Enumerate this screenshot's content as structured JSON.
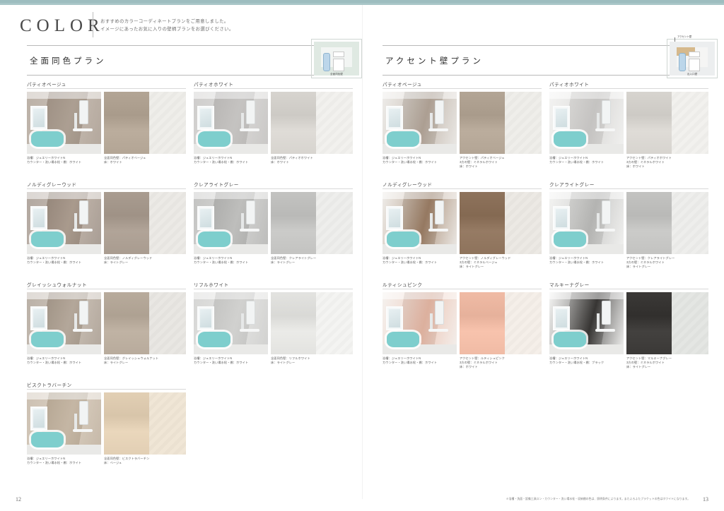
{
  "header": {
    "title": "COLOR",
    "lead_line1": "おすすめのカラーコーディネートプランをご用意しました。",
    "lead_line2": "イメージにあったお気に入りの壁柄プランをお選びください。"
  },
  "colors": {
    "top_bar": "#a8c5c7",
    "rule": "#b9b9b9",
    "text": "#4a4a4a",
    "accent_wall_swatch": "#d6b98c",
    "tub": "#7ececd"
  },
  "sections": [
    {
      "id": "zenmen",
      "title": "全面同色プラン",
      "thumb": {
        "type": "same-color-plan-diagram",
        "caption": "全面同色壁",
        "labels": [
          "鏡",
          "カウンター",
          "出入口"
        ]
      },
      "cards": [
        {
          "title": "パティオベージュ",
          "photo_wall": "#b5a79a",
          "photo_wall2": "#9d8e80",
          "sw_main": "#b3a595",
          "sw_side": "#efeeea",
          "cap_left": [
            "浴槽：ジュエリーホワイトN",
            "カウンター・洗い場水栓・棚：ホワイト"
          ],
          "cap_right": [
            "全面同色壁：パティオベージュ",
            "床：ホワイト"
          ]
        },
        {
          "title": "パティオホワイト",
          "photo_wall": "#cfcdcb",
          "photo_wall2": "#b9b7b5",
          "sw_main": "#d7d4cf",
          "sw_side": "#f2f1ee",
          "cap_left": [
            "浴槽：ジュエリーホワイトN",
            "カウンター・洗い場水栓・棚：ホワイト"
          ],
          "cap_right": [
            "全面同色壁：パティオホワイト",
            "床：ホワイト"
          ]
        },
        {
          "title": "ノルディグレーウッド",
          "photo_wall": "#b2a294",
          "photo_wall2": "#8e8075",
          "sw_main": "#a99c90",
          "sw_side": "#eceae6",
          "cap_left": [
            "浴槽：ジュエリーホワイトN",
            "カウンター・洗い場水栓・棚：ホワイト"
          ],
          "cap_right": [
            "全面同色壁：ノルディグレーウッド",
            "床：ライトグレー"
          ]
        },
        {
          "title": "クレアライトグレー",
          "photo_wall": "#c8c8c6",
          "photo_wall2": "#a9a9a7",
          "sw_main": "#c3c3c1",
          "sw_side": "#eeeeec",
          "cap_left": [
            "浴槽：ジュエリーホワイトN",
            "カウンター・洗い場水栓・棚：ホワイト"
          ],
          "cap_right": [
            "全面同色壁：クレアライトグレー",
            "床：ライトグレー"
          ]
        },
        {
          "title": "グレイッシュウォルナット",
          "photo_wall": "#bdb0a2",
          "photo_wall2": "#9b8d7f",
          "sw_main": "#b8ab9c",
          "sw_side": "#e9e7e3",
          "cap_left": [
            "浴槽：ジュエリーホワイトN",
            "カウンター・洗い場水栓・棚：ホワイト"
          ],
          "cap_right": [
            "全面同色壁：グレイッシュウォルナット",
            "床：ライトグレー"
          ]
        },
        {
          "title": "リフルホワイト",
          "photo_wall": "#dcdcda",
          "photo_wall2": "#c4c4c2",
          "sw_main": "#e3e3e0",
          "sw_side": "#f4f4f2",
          "cap_left": [
            "浴槽：ジュエリーホワイトN",
            "カウンター・洗い場水栓・棚：ホワイト"
          ],
          "cap_right": [
            "全面同色壁：リフルホワイト",
            "床：ライトグレー"
          ]
        },
        {
          "title": "ビスクトラバーチン",
          "photo_wall": "#cfc0ad",
          "photo_wall2": "#b5a48f",
          "sw_main": "#e2cfb4",
          "sw_side": "#f0e6d6",
          "cap_left": [
            "浴槽：ジュエリーホワイトN",
            "カウンター・洗い場水栓・棚：ホワイト"
          ],
          "cap_right": [
            "全面同色壁：ビスクトラバーチン",
            "床：ベージュ"
          ]
        }
      ]
    },
    {
      "id": "accent",
      "title": "アクセント壁プラン",
      "thumb": {
        "type": "accent-wall-plan-diagram",
        "caption": "出入口壁",
        "accent_label": "アクセント壁",
        "labels": [
          "鏡",
          "カウンター",
          "出入口"
        ]
      },
      "cards": [
        {
          "title": "パティオベージュ",
          "photo_wall": "#b5a79a",
          "photo_wall2": "#e6e4e0",
          "sw_main": "#b3a595",
          "sw_side": "#efeeea",
          "cap_left": [
            "浴槽：ジュエリーホワイトN",
            "カウンター・洗い場水栓・棚：ホワイト"
          ],
          "cap_right": [
            "アクセント壁：パティオベージュ",
            "3方の壁：ミネラルホワイト",
            "床：ホワイト"
          ]
        },
        {
          "title": "パティオホワイト",
          "photo_wall": "#cfcdcb",
          "photo_wall2": "#eeeeec",
          "sw_main": "#d7d4cf",
          "sw_side": "#f2f1ee",
          "cap_left": [
            "浴槽：ジュエリーホワイトN",
            "カウンター・洗い場水栓・棚：ホワイト"
          ],
          "cap_right": [
            "アクセント壁：パティオホワイト",
            "3方の壁：ミネラルホワイト",
            "床：ホワイト"
          ]
        },
        {
          "title": "ノルディグレーウッド",
          "photo_wall": "#9d7f66",
          "photo_wall2": "#e8e5e0",
          "sw_main": "#8e735c",
          "sw_side": "#ece9e4",
          "cap_left": [
            "浴槽：ジュエリーホワイトN",
            "カウンター・洗い場水栓・棚：ホワイト"
          ],
          "cap_right": [
            "アクセント壁：ノルディグレーウッド",
            "3方の壁：ミネラルベージュ",
            "床：ライトグレー"
          ]
        },
        {
          "title": "クレアライトグレー",
          "photo_wall": "#bdbdbb",
          "photo_wall2": "#eeeeec",
          "sw_main": "#c3c3c1",
          "sw_side": "#eeeeec",
          "cap_left": [
            "浴槽：ジュエリーホワイトN",
            "カウンター・洗い場水栓・棚：ホワイト"
          ],
          "cap_right": [
            "アクセント壁：クレアライトグレー",
            "3方の壁：ミネラルホワイト",
            "床：ライトグレー"
          ]
        },
        {
          "title": "ルティシュピンク",
          "photo_wall": "#e8b9a6",
          "photo_wall2": "#f0ece8",
          "sw_main": "#f0bba5",
          "sw_side": "#f5efe9",
          "cap_left": [
            "浴槽：ジュエリーホワイトN",
            "カウンター・洗い場水栓・棚：ホワイト"
          ],
          "cap_right": [
            "アクセント壁：ルティシュピンク",
            "3方の壁：ミネラルホワイト",
            "床：ホワイト"
          ]
        },
        {
          "title": "マルキーナグレー",
          "photo_wall": "#3a3836",
          "photo_wall2": "#f0f0ee",
          "sw_main": "#3b3937",
          "sw_side": "#e4e6e3",
          "cap_left": [
            "浴槽：ジュエリーホワイトN",
            "カウンター・洗い場水栓・棚：ブラック"
          ],
          "cap_right": [
            "アクセント壁：マルキーナグレー",
            "3方の壁：ミネラルホワイト",
            "床：ライトグレー"
          ]
        }
      ]
    }
  ],
  "footer": {
    "page_left": "12",
    "page_right": "13",
    "note": "※浴槽・洗面・設備工具ロン・カウンター・洗い場水栓・収納棚の色は、照明条件によります。またふろふたブラケットの色はホワイトになります。"
  }
}
